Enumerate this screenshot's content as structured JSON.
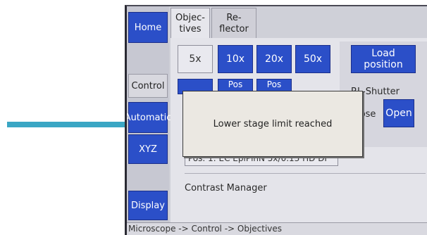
{
  "sidebar": {
    "home_label": "Home",
    "control_label": "Control",
    "automatic_label": "Automatic",
    "xyz_label": "XYZ",
    "display_label": "Display"
  },
  "tabs": [
    {
      "label": "Objec-\ntives"
    },
    {
      "label": "Re-\nflector"
    }
  ],
  "objectives": {
    "buttons": [
      "5x",
      "10x",
      "20x",
      "50x"
    ],
    "pos_buttons": [
      "Pos",
      "Pos"
    ],
    "current": "Pos. 1: EC EpiPlnN 5x/0.13 HD DI"
  },
  "right_panel": {
    "load_label": "Load\nposition",
    "shutter_label": "RL-Shutter",
    "close_label": "Close",
    "open_label": "Open"
  },
  "contrast_manager": "Contrast Manager",
  "popup": {
    "message": "Lower stage limit reached"
  },
  "status_bar": {
    "path": "Microscope -> Control -> Objectives"
  },
  "colors": {
    "accent": "#2b4fc8",
    "arrow": "#3aa6c4"
  }
}
